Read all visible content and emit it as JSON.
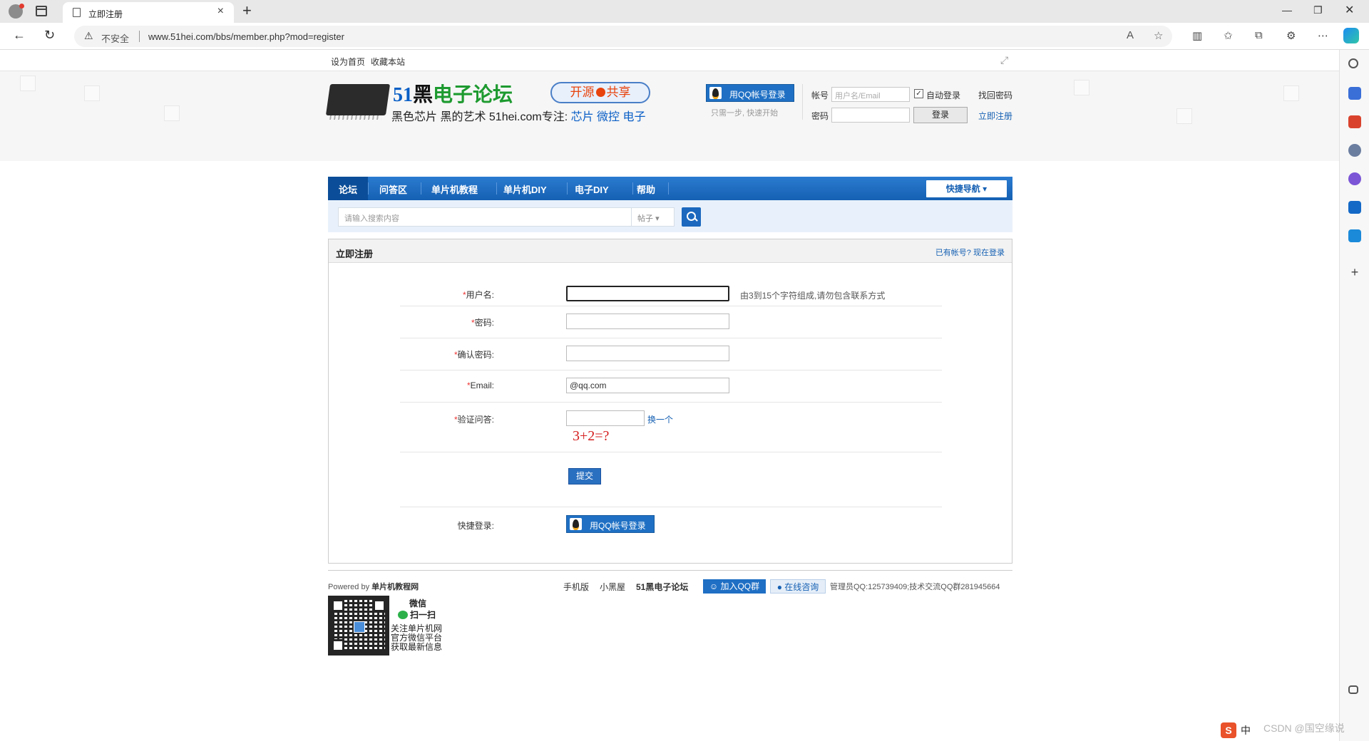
{
  "browser": {
    "tab_title": "立即注册",
    "security_label": "不安全",
    "url": "www.51hei.com/bbs/member.php?mod=register"
  },
  "toplinks": {
    "home": "设为首页",
    "fav": "收藏本站"
  },
  "header": {
    "logo_num": "51",
    "logo_hei": "黑",
    "logo_forum": "电子论坛",
    "slogan_pre": "黑色芯片 黑的艺术  51hei.com专注: ",
    "slogan_tags": "芯片  微控  电子",
    "pill_left": "开源",
    "pill_right": "共享",
    "qq_login": "用QQ帐号登录",
    "qq_tip": "只需一步, 快速开始",
    "account_label": "帐号",
    "account_placeholder": "用户名/Email",
    "auto_login": "自动登录",
    "forgot": "找回密码",
    "password_label": "密码",
    "login_btn": "登录",
    "register_link": "立即注册"
  },
  "nav": {
    "items": [
      "论坛",
      "问答区",
      "单片机教程",
      "单片机DIY",
      "电子DIY",
      "帮助"
    ],
    "quick_nav": "快捷导航"
  },
  "search": {
    "placeholder": "请输入搜索内容",
    "type": "帖子"
  },
  "register": {
    "title": "立即注册",
    "have_account": "已有帐号? 现在登录",
    "username_label": "用户名:",
    "username_tip": "由3到15个字符组成,请勿包含联系方式",
    "password_label": "密码:",
    "confirm_label": "确认密码:",
    "email_label": "Email:",
    "email_value": "@qq.com",
    "verify_label": "验证问答:",
    "change": "换一个",
    "question": "3+2=?",
    "submit": "提交",
    "quick_login_label": "快捷登录:",
    "quick_login_btn": "用QQ帐号登录",
    "required_mark": "*"
  },
  "footer": {
    "powered_prefix": "Powered by ",
    "powered_name": "单片机教程网",
    "links": [
      "手机版",
      "小黑屋",
      "51黑电子论坛"
    ],
    "join_qq": "加入QQ群",
    "online": "在线咨询",
    "admin": "管理员QQ:125739409;技术交流QQ群281945664",
    "wx_title": "微信",
    "wx_scan": "扫一扫",
    "wx_line1": "关注单片机网",
    "wx_line2": "官方微信平台",
    "wx_line3": "获取最新信息"
  },
  "tray": {
    "ime": "中",
    "watermark": "CSDN @国空缘说"
  }
}
